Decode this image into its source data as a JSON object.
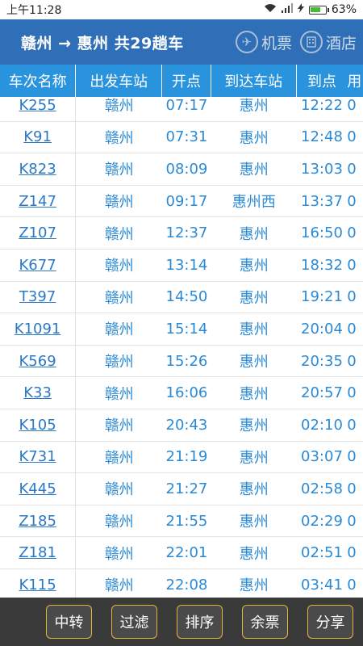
{
  "status_bar": {
    "time": "上午11:28",
    "battery": "63%"
  },
  "header": {
    "title": "赣州 → 惠州 共29趟车",
    "actions": [
      {
        "label": "机票",
        "icon": "plane-icon"
      },
      {
        "label": "酒店",
        "icon": "hotel-icon"
      }
    ]
  },
  "columns": [
    "车次名称",
    "出发车站",
    "开点",
    "到达车站",
    "到点",
    "用"
  ],
  "rows": [
    {
      "train": "K255",
      "from": "赣州",
      "dep": "07:17",
      "to": "惠州",
      "arr": "12:22",
      "extra": "0"
    },
    {
      "train": "K91",
      "from": "赣州",
      "dep": "07:31",
      "to": "惠州",
      "arr": "12:48",
      "extra": "0"
    },
    {
      "train": "K823",
      "from": "赣州",
      "dep": "08:09",
      "to": "惠州",
      "arr": "13:03",
      "extra": "0"
    },
    {
      "train": "Z147",
      "from": "赣州",
      "dep": "09:17",
      "to": "惠州西",
      "arr": "13:37",
      "extra": "0"
    },
    {
      "train": "Z107",
      "from": "赣州",
      "dep": "12:37",
      "to": "惠州",
      "arr": "16:50",
      "extra": "0"
    },
    {
      "train": "K677",
      "from": "赣州",
      "dep": "13:14",
      "to": "惠州",
      "arr": "18:32",
      "extra": "0"
    },
    {
      "train": "T397",
      "from": "赣州",
      "dep": "14:50",
      "to": "惠州",
      "arr": "19:21",
      "extra": "0"
    },
    {
      "train": "K1091",
      "from": "赣州",
      "dep": "15:14",
      "to": "惠州",
      "arr": "20:04",
      "extra": "0"
    },
    {
      "train": "K569",
      "from": "赣州",
      "dep": "15:26",
      "to": "惠州",
      "arr": "20:35",
      "extra": "0"
    },
    {
      "train": "K33",
      "from": "赣州",
      "dep": "16:06",
      "to": "惠州",
      "arr": "20:57",
      "extra": "0"
    },
    {
      "train": "K105",
      "from": "赣州",
      "dep": "20:43",
      "to": "惠州",
      "arr": "02:10",
      "extra": "0"
    },
    {
      "train": "K731",
      "from": "赣州",
      "dep": "21:19",
      "to": "惠州",
      "arr": "03:07",
      "extra": "0"
    },
    {
      "train": "K445",
      "from": "赣州",
      "dep": "21:27",
      "to": "惠州",
      "arr": "02:58",
      "extra": "0"
    },
    {
      "train": "Z185",
      "from": "赣州",
      "dep": "21:55",
      "to": "惠州",
      "arr": "02:29",
      "extra": "0"
    },
    {
      "train": "Z181",
      "from": "赣州",
      "dep": "22:01",
      "to": "惠州",
      "arr": "02:51",
      "extra": "0"
    },
    {
      "train": "K115",
      "from": "赣州",
      "dep": "22:08",
      "to": "惠州",
      "arr": "03:41",
      "extra": "0"
    }
  ],
  "bottom_bar": {
    "buttons": [
      "中转",
      "过滤",
      "排序",
      "余票",
      "分享"
    ]
  },
  "colors": {
    "header_bg": "#2e6fb8",
    "column_header_bg": "#2a93dd",
    "link": "#2a78c6",
    "bottom_bg": "#3a3a3a",
    "button_border": "#e2b43a"
  }
}
